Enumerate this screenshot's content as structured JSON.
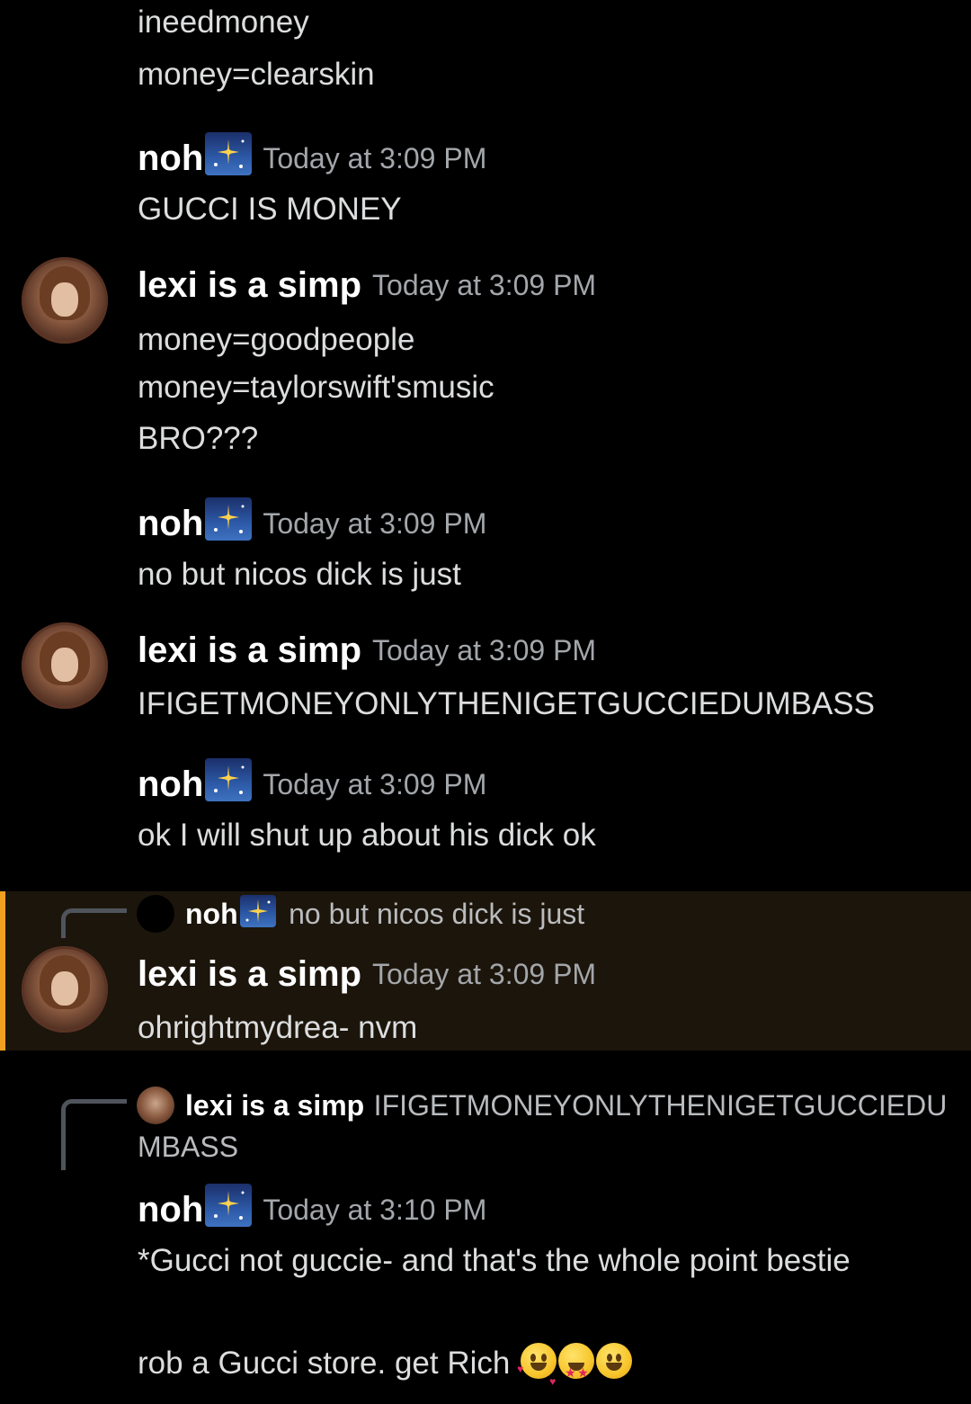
{
  "users": {
    "noh": "noh",
    "lexi": "lexi is a simp"
  },
  "messages": [
    {
      "type": "continuation",
      "text": "ineedmoney"
    },
    {
      "type": "continuation",
      "text": "money=clearskin"
    },
    {
      "type": "header",
      "author": "noh",
      "timestamp": "Today at 3:09 PM"
    },
    {
      "type": "continuation",
      "text": "GUCCI IS MONEY"
    },
    {
      "type": "header",
      "author": "lexi is a simp",
      "timestamp": "Today at 3:09 PM"
    },
    {
      "type": "continuation",
      "text": "money=goodpeople"
    },
    {
      "type": "continuation",
      "text": "money=taylorswift'smusic"
    },
    {
      "type": "continuation",
      "text": "BRO???"
    },
    {
      "type": "header",
      "author": "noh",
      "timestamp": "Today at 3:09 PM"
    },
    {
      "type": "continuation",
      "text": "no but nicos dick is just"
    },
    {
      "type": "header",
      "author": "lexi is a simp",
      "timestamp": "Today at 3:09 PM"
    },
    {
      "type": "continuation",
      "text": "IFIGETMONEYONLYTHENIGETGUCCIEDUMBASS"
    },
    {
      "type": "header",
      "author": "noh",
      "timestamp": "Today at 3:09 PM"
    },
    {
      "type": "continuation",
      "text": "ok I will shut up about his dick ok"
    }
  ],
  "reply1": {
    "ref_author": "noh",
    "ref_text": "no but nicos dick is just",
    "author": "lexi is a simp",
    "timestamp": "Today at 3:09 PM",
    "text": "ohrightmydrea- nvm"
  },
  "reply2": {
    "ref_author": "lexi is a simp",
    "ref_text_line1": "IFIGETMONEYONLYTHENIGETGUCCIEDU",
    "ref_text_line2": "MBASS",
    "author": "noh",
    "timestamp": "Today at 3:10 PM",
    "text_line1": "*Gucci not guccie- and that's the whole point bestie",
    "text_line2": "rob a Gucci store. get Rich"
  },
  "emojis": [
    "smiling-face-with-hearts",
    "star-struck",
    "grinning-face"
  ],
  "colors": {
    "background": "#000000",
    "text": "#dcddde",
    "timestamp": "#a3a6aa",
    "mention_highlight": "#1c150b",
    "mention_bar": "#f0a020"
  }
}
